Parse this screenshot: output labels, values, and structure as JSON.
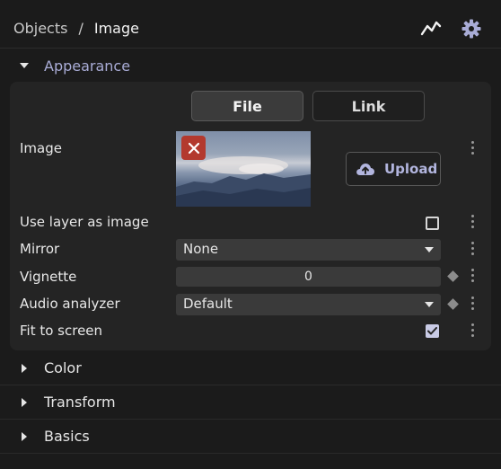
{
  "breadcrumb": {
    "root": "Objects",
    "separator": "/",
    "current": "Image"
  },
  "header_icons": {
    "graph": "graph-icon",
    "settings": "gear-icon"
  },
  "sections": {
    "appearance": "Appearance",
    "color": "Color",
    "transform": "Transform",
    "basics": "Basics"
  },
  "tabs": {
    "file": "File",
    "link": "Link",
    "active": "File"
  },
  "image": {
    "label": "Image",
    "upload_label": "Upload"
  },
  "rows": {
    "use_layer": {
      "label": "Use layer as image",
      "checked": false
    },
    "mirror": {
      "label": "Mirror",
      "value": "None"
    },
    "vignette": {
      "label": "Vignette",
      "value": "0"
    },
    "audio": {
      "label": "Audio analyzer",
      "value": "Default"
    },
    "fit": {
      "label": "Fit to screen",
      "checked": true
    }
  },
  "colors": {
    "accent": "#a9acd6",
    "remove": "#b3392e",
    "background": "#1b1b1b",
    "panel": "#242424"
  }
}
